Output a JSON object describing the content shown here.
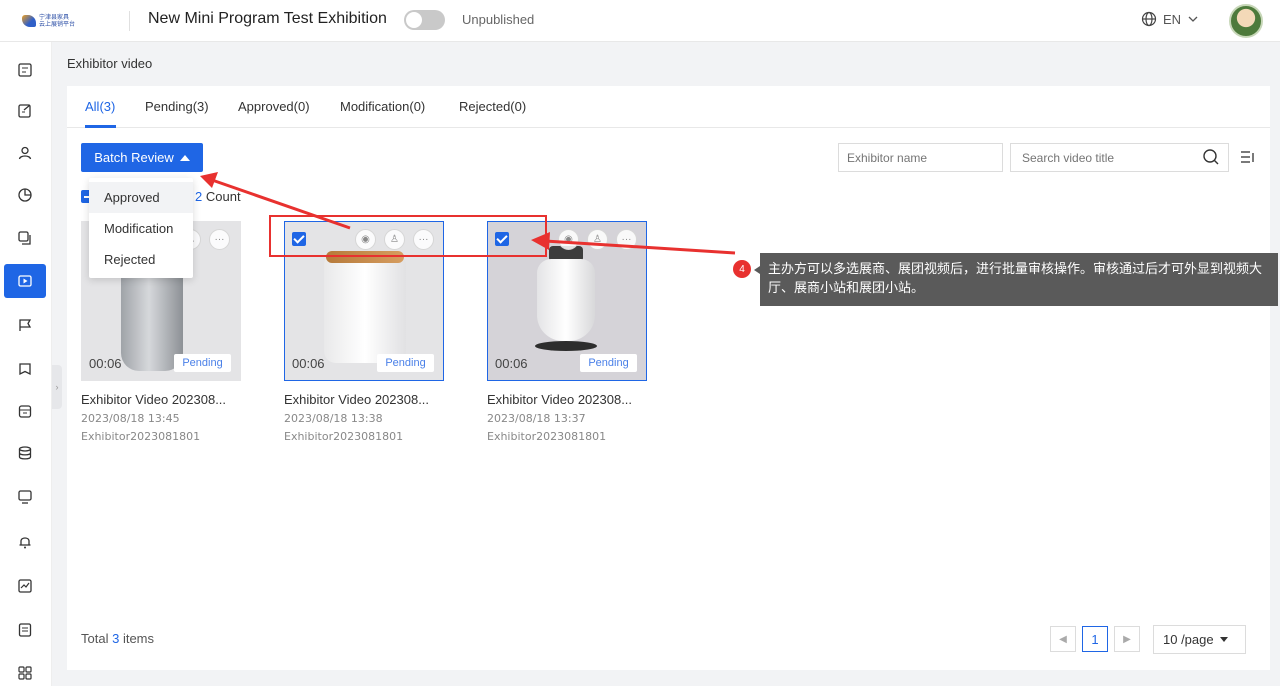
{
  "header": {
    "logo_text": "宁津县家具\n云上展销平台",
    "title": "New Mini Program Test Exhibition",
    "status": "Unpublished",
    "language": "EN"
  },
  "breadcrumb": "Exhibitor video",
  "tabs": [
    {
      "label": "All(3)",
      "active": true
    },
    {
      "label": "Pending(3)"
    },
    {
      "label": "Approved(0)"
    },
    {
      "label": "Modification(0)"
    },
    {
      "label": "Rejected(0)"
    }
  ],
  "toolbar": {
    "batch_label": "Batch Review",
    "exhibitor_placeholder": "Exhibitor name",
    "video_placeholder": "Search video title"
  },
  "selection": {
    "count": "2",
    "suffix": "Count"
  },
  "dropdown": [
    "Approved",
    "Modification",
    "Rejected"
  ],
  "videos": [
    {
      "title": "Exhibitor Video 202308...",
      "date": "2023/08/18 13:45",
      "exhibitor": "Exhibitor2023081801",
      "duration": "00:06",
      "status": "Pending"
    },
    {
      "title": "Exhibitor Video 202308...",
      "date": "2023/08/18 13:38",
      "exhibitor": "Exhibitor2023081801",
      "duration": "00:06",
      "status": "Pending"
    },
    {
      "title": "Exhibitor Video 202308...",
      "date": "2023/08/18 13:37",
      "exhibitor": "Exhibitor2023081801",
      "duration": "00:06",
      "status": "Pending"
    }
  ],
  "annotation": {
    "number": "4",
    "text": "主办方可以多选展商、展团视频后，进行批量审核操作。审核通过后才可外显到视频大厅、展商小站和展团小站。"
  },
  "footer": {
    "total_prefix": "Total",
    "total_count": "3",
    "total_suffix": "items",
    "current_page": "1",
    "page_size": "10 /page"
  },
  "colors": {
    "primary": "#1f66e5",
    "annotation": "#e8312f"
  }
}
